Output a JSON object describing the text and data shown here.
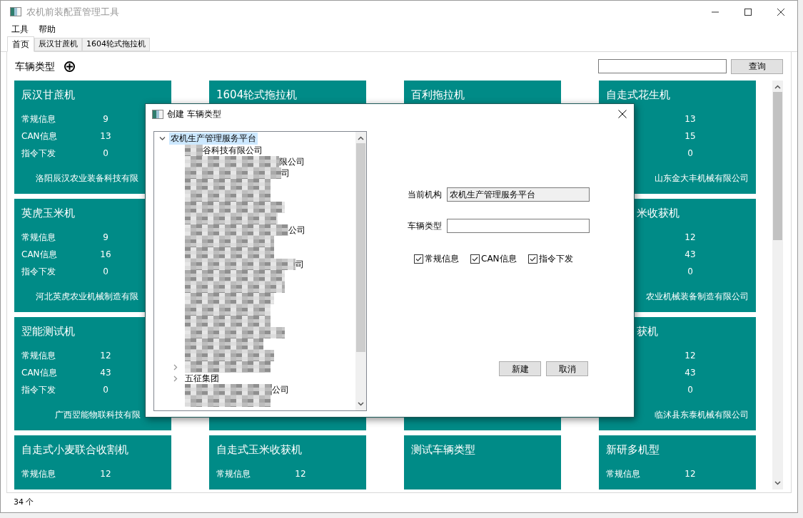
{
  "window": {
    "title": "农机前装配置管理工具"
  },
  "menu": [
    "工具",
    "帮助"
  ],
  "tabs": [
    {
      "label": "首页",
      "selected": true
    },
    {
      "label": "辰汉甘蔗机",
      "selected": false
    },
    {
      "label": "1604轮式拖拉机",
      "selected": false
    }
  ],
  "header": {
    "title": "车辆类型",
    "search_button": "查询"
  },
  "cards": [
    {
      "title": "辰汉甘蔗机",
      "stats": [
        {
          "label": "常规信息",
          "value": "9"
        },
        {
          "label": "CAN信息",
          "value": "13"
        },
        {
          "label": "指令下发",
          "value": "0"
        }
      ],
      "company": "洛阳辰汉农业装备科技有限"
    },
    {
      "title": "1604轮式拖拉机"
    },
    {
      "title": "百利拖拉机"
    },
    {
      "title": "自走式花生机",
      "stats": [
        {
          "value": "13"
        },
        {
          "value": "15"
        },
        {
          "value": "0"
        }
      ],
      "company": "山东金大丰机械有限公司"
    },
    {
      "title": "英虎玉米机",
      "stats": [
        {
          "label": "常规信息",
          "value": "9"
        },
        {
          "label": "CAN信息",
          "value": "16"
        },
        {
          "label": "指令下发",
          "value": "0"
        }
      ],
      "company": "河北英虎农业机械制造有限"
    },
    {
      "title": "米收获机",
      "stats": [
        {
          "value": "12"
        },
        {
          "value": "43"
        },
        {
          "value": "0"
        }
      ],
      "company": "农业机械装备制造有限公司"
    },
    {
      "title": "翌能测试机",
      "stats": [
        {
          "label": "常规信息",
          "value": "12"
        },
        {
          "label": "CAN信息",
          "value": "43"
        },
        {
          "label": "指令下发",
          "value": "0"
        }
      ],
      "company": "广西翌能物联科技有限"
    },
    {
      "title": "获机",
      "stats": [
        {
          "value": "12"
        },
        {
          "value": "43"
        },
        {
          "value": "0"
        }
      ],
      "company": "临沭县东泰机械有限公司"
    },
    {
      "title": "自走式小麦联合收割机",
      "stats": [
        {
          "label": "常规信息",
          "value": "12"
        }
      ]
    },
    {
      "title": "自走式玉米收获机",
      "stats": [
        {
          "label": "常规信息",
          "value": "12"
        }
      ]
    },
    {
      "title": "测试车辆类型"
    },
    {
      "title": "新研多机型",
      "stats": [
        {
          "label": "常规信息",
          "value": "12"
        }
      ]
    }
  ],
  "status_bar": "34 个",
  "dialog": {
    "title": "创建 车辆类型",
    "tree": [
      {
        "text": "农机生产管理服务平台",
        "expanded": true,
        "selected": true,
        "children": [
          {
            "redacted": true,
            "text": "谷科技有限公司"
          },
          {
            "redacted": true,
            "text": "限公司"
          },
          {
            "redacted": true,
            "text": "司"
          },
          {
            "redacted": true
          },
          {
            "redacted": true
          },
          {
            "redacted": true
          },
          {
            "redacted": true
          },
          {
            "redacted": true,
            "text": "公司"
          },
          {
            "redacted": true
          },
          {
            "redacted": true
          },
          {
            "redacted": true,
            "text": "司"
          },
          {
            "redacted": true
          },
          {
            "redacted": true
          },
          {
            "redacted": true
          },
          {
            "redacted": true
          },
          {
            "redacted": true
          },
          {
            "redacted": true
          },
          {
            "redacted": true
          },
          {
            "redacted": true
          },
          {
            "redacted": true,
            "expanded": false
          },
          {
            "redacted": false,
            "text": "五征集团",
            "expanded": false
          },
          {
            "redacted": true,
            "text": "公司"
          },
          {
            "redacted": true
          }
        ]
      }
    ],
    "fields": [
      {
        "label": "当前机构",
        "value": "农机生产管理服务平台",
        "readonly": true
      },
      {
        "label": "车辆类型",
        "readonly": false
      }
    ],
    "checkboxes": [
      {
        "label": "常规信息",
        "checked": true
      },
      {
        "label": "CAN信息",
        "checked": true
      },
      {
        "label": "指令下发",
        "checked": true
      }
    ],
    "buttons": [
      "新建",
      "取消"
    ]
  }
}
